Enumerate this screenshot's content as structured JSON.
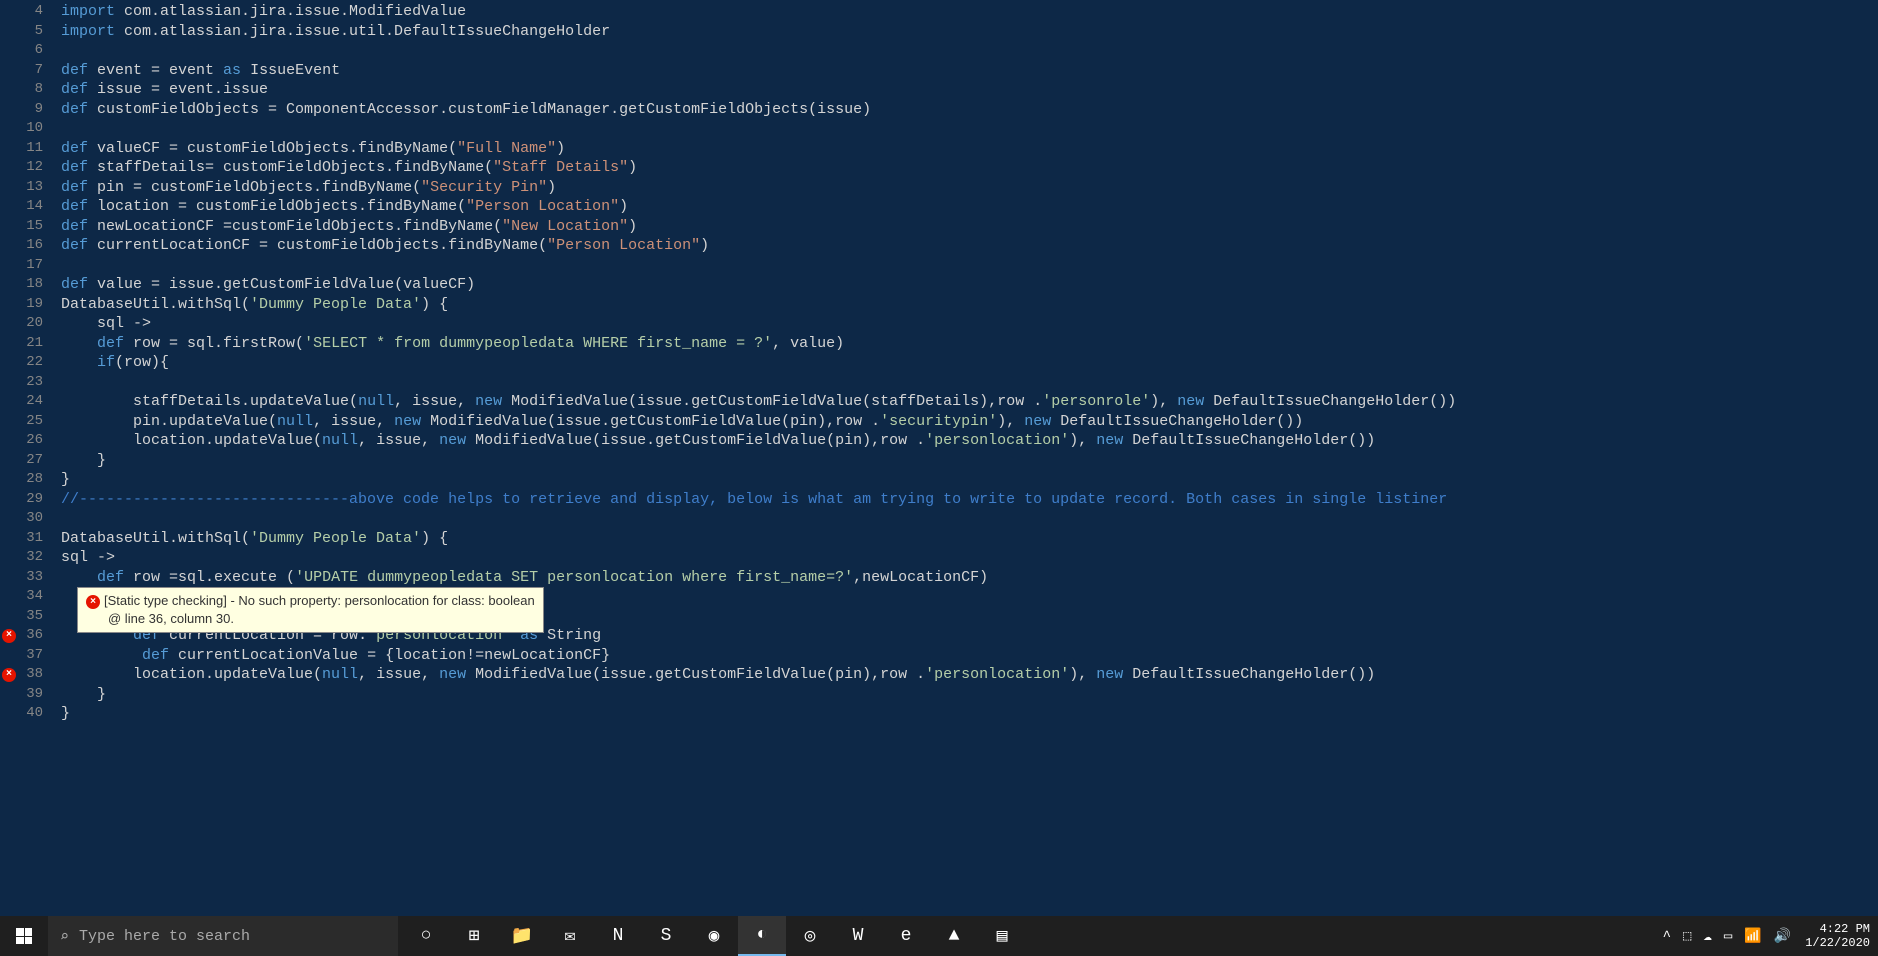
{
  "editor": {
    "startLine": 4,
    "lines": [
      [
        {
          "t": "kw",
          "v": "import"
        },
        {
          "t": "plain",
          "v": " com.atlassian.jira.issue.ModifiedValue"
        }
      ],
      [
        {
          "t": "kw",
          "v": "import"
        },
        {
          "t": "plain",
          "v": " com.atlassian.jira.issue.util.DefaultIssueChangeHolder"
        }
      ],
      [],
      [
        {
          "t": "kw",
          "v": "def"
        },
        {
          "t": "plain",
          "v": " event = event "
        },
        {
          "t": "kw",
          "v": "as"
        },
        {
          "t": "plain",
          "v": " IssueEvent"
        }
      ],
      [
        {
          "t": "kw",
          "v": "def"
        },
        {
          "t": "plain",
          "v": " issue = event.issue"
        }
      ],
      [
        {
          "t": "kw",
          "v": "def"
        },
        {
          "t": "plain",
          "v": " customFieldObjects = ComponentAccessor.customFieldManager.getCustomFieldObjects(issue)"
        }
      ],
      [],
      [
        {
          "t": "kw",
          "v": "def"
        },
        {
          "t": "plain",
          "v": " valueCF = customFieldObjects.findByName("
        },
        {
          "t": "str",
          "v": "\"Full Name\""
        },
        {
          "t": "plain",
          "v": ")"
        }
      ],
      [
        {
          "t": "kw",
          "v": "def"
        },
        {
          "t": "plain",
          "v": " staffDetails= customFieldObjects.findByName("
        },
        {
          "t": "str",
          "v": "\"Staff Details\""
        },
        {
          "t": "plain",
          "v": ")"
        }
      ],
      [
        {
          "t": "kw",
          "v": "def"
        },
        {
          "t": "plain",
          "v": " pin = customFieldObjects.findByName("
        },
        {
          "t": "str",
          "v": "\"Security Pin\""
        },
        {
          "t": "plain",
          "v": ")"
        }
      ],
      [
        {
          "t": "kw",
          "v": "def"
        },
        {
          "t": "plain",
          "v": " location = customFieldObjects.findByName("
        },
        {
          "t": "str",
          "v": "\"Person Location\""
        },
        {
          "t": "plain",
          "v": ")"
        }
      ],
      [
        {
          "t": "kw",
          "v": "def"
        },
        {
          "t": "plain",
          "v": " newLocationCF =customFieldObjects.findByName("
        },
        {
          "t": "str",
          "v": "\"New Location\""
        },
        {
          "t": "plain",
          "v": ")"
        }
      ],
      [
        {
          "t": "kw",
          "v": "def"
        },
        {
          "t": "plain",
          "v": " currentLocationCF = customFieldObjects.findByName("
        },
        {
          "t": "str",
          "v": "\"Person Location\""
        },
        {
          "t": "plain",
          "v": ")"
        }
      ],
      [],
      [
        {
          "t": "kw",
          "v": "def"
        },
        {
          "t": "plain",
          "v": " value = issue.getCustomFieldValue(valueCF)"
        }
      ],
      [
        {
          "t": "plain",
          "v": "DatabaseUtil.withSql("
        },
        {
          "t": "str2",
          "v": "'Dummy People Data'"
        },
        {
          "t": "plain",
          "v": ") {"
        }
      ],
      [
        {
          "t": "plain",
          "v": "    sql ->"
        }
      ],
      [
        {
          "t": "plain",
          "v": "    "
        },
        {
          "t": "kw",
          "v": "def"
        },
        {
          "t": "plain",
          "v": " row = sql.firstRow("
        },
        {
          "t": "str2",
          "v": "'SELECT * from dummypeopledata WHERE first_name = ?'"
        },
        {
          "t": "plain",
          "v": ", value)"
        }
      ],
      [
        {
          "t": "plain",
          "v": "    "
        },
        {
          "t": "kw",
          "v": "if"
        },
        {
          "t": "plain",
          "v": "(row){"
        }
      ],
      [],
      [
        {
          "t": "plain",
          "v": "        staffDetails.updateValue("
        },
        {
          "t": "null",
          "v": "null"
        },
        {
          "t": "plain",
          "v": ", issue, "
        },
        {
          "t": "kw",
          "v": "new"
        },
        {
          "t": "plain",
          "v": " ModifiedValue(issue.getCustomFieldValue(staffDetails),row ."
        },
        {
          "t": "str2",
          "v": "'personrole'"
        },
        {
          "t": "plain",
          "v": "), "
        },
        {
          "t": "kw",
          "v": "new"
        },
        {
          "t": "plain",
          "v": " DefaultIssueChangeHolder())"
        }
      ],
      [
        {
          "t": "plain",
          "v": "        pin.updateValue("
        },
        {
          "t": "null",
          "v": "null"
        },
        {
          "t": "plain",
          "v": ", issue, "
        },
        {
          "t": "kw",
          "v": "new"
        },
        {
          "t": "plain",
          "v": " ModifiedValue(issue.getCustomFieldValue(pin),row ."
        },
        {
          "t": "str2",
          "v": "'securitypin'"
        },
        {
          "t": "plain",
          "v": "), "
        },
        {
          "t": "kw",
          "v": "new"
        },
        {
          "t": "plain",
          "v": " DefaultIssueChangeHolder())"
        }
      ],
      [
        {
          "t": "plain",
          "v": "        location.updateValue("
        },
        {
          "t": "null",
          "v": "null"
        },
        {
          "t": "plain",
          "v": ", issue, "
        },
        {
          "t": "kw",
          "v": "new"
        },
        {
          "t": "plain",
          "v": " ModifiedValue(issue.getCustomFieldValue(pin),row ."
        },
        {
          "t": "str2",
          "v": "'personlocation'"
        },
        {
          "t": "plain",
          "v": "), "
        },
        {
          "t": "kw",
          "v": "new"
        },
        {
          "t": "plain",
          "v": " DefaultIssueChangeHolder())"
        }
      ],
      [
        {
          "t": "plain",
          "v": "    }"
        }
      ],
      [
        {
          "t": "plain",
          "v": "}"
        }
      ],
      [
        {
          "t": "comment",
          "v": "//------------------------------above code helps to retrieve and display, below is what am trying to write to update record. Both cases in single listiner"
        }
      ],
      [],
      [
        {
          "t": "plain",
          "v": "DatabaseUtil.withSql("
        },
        {
          "t": "str2",
          "v": "'Dummy People Data'"
        },
        {
          "t": "plain",
          "v": ") {"
        }
      ],
      [
        {
          "t": "plain",
          "v": "sql ->"
        }
      ],
      [
        {
          "t": "plain",
          "v": "    "
        },
        {
          "t": "kw",
          "v": "def"
        },
        {
          "t": "plain",
          "v": " row =sql.execute ("
        },
        {
          "t": "str2",
          "v": "'UPDATE dummypeopledata SET personlocation where first_name=?'"
        },
        {
          "t": "plain",
          "v": ",newLocationCF)"
        }
      ],
      [],
      [],
      [
        {
          "t": "plain",
          "v": "        "
        },
        {
          "t": "kw",
          "v": "def"
        },
        {
          "t": "plain",
          "v": " currentLocation = row."
        },
        {
          "t": "str2",
          "v": "'personlocation'"
        },
        {
          "t": "plain",
          "v": " "
        },
        {
          "t": "kw",
          "v": "as"
        },
        {
          "t": "plain",
          "v": " String"
        }
      ],
      [
        {
          "t": "plain",
          "v": "         "
        },
        {
          "t": "kw",
          "v": "def"
        },
        {
          "t": "plain",
          "v": " currentLocationValue = {location!=newLocationCF}"
        }
      ],
      [
        {
          "t": "plain",
          "v": "        location.updateValue("
        },
        {
          "t": "null",
          "v": "null"
        },
        {
          "t": "plain",
          "v": ", issue, "
        },
        {
          "t": "kw",
          "v": "new"
        },
        {
          "t": "plain",
          "v": " ModifiedValue(issue.getCustomFieldValue(pin),row ."
        },
        {
          "t": "str2",
          "v": "'personlocation'"
        },
        {
          "t": "plain",
          "v": "), "
        },
        {
          "t": "kw",
          "v": "new"
        },
        {
          "t": "plain",
          "v": " DefaultIssueChangeHolder())"
        }
      ],
      [
        {
          "t": "plain",
          "v": "    }"
        }
      ],
      [
        {
          "t": "plain",
          "v": "}"
        }
      ]
    ],
    "errorLines": [
      36,
      38
    ],
    "tooltip": {
      "beforeLineIndex": 32,
      "message": "[Static type checking] - No such property: personlocation for class: boolean",
      "location": "@ line 36, column 30."
    }
  },
  "taskbar": {
    "searchPlaceholder": "Type here to search",
    "items": [
      {
        "name": "cortana",
        "glyph": "○"
      },
      {
        "name": "taskview",
        "glyph": "⊞"
      },
      {
        "name": "explorer",
        "glyph": "📁"
      },
      {
        "name": "mail",
        "glyph": "✉"
      },
      {
        "name": "onenote",
        "glyph": "N"
      },
      {
        "name": "sublime",
        "glyph": "S"
      },
      {
        "name": "app1",
        "glyph": "◉"
      },
      {
        "name": "chrome",
        "glyph": "◐",
        "active": true
      },
      {
        "name": "app2",
        "glyph": "◎"
      },
      {
        "name": "word",
        "glyph": "W"
      },
      {
        "name": "edge",
        "glyph": "e"
      },
      {
        "name": "photos",
        "glyph": "▲"
      },
      {
        "name": "notes",
        "glyph": "▤"
      }
    ],
    "tray": [
      "^",
      "⬚",
      "☁",
      "▭",
      "📶",
      "🔊"
    ],
    "time": "4:22 PM",
    "date": "1/22/2020"
  }
}
